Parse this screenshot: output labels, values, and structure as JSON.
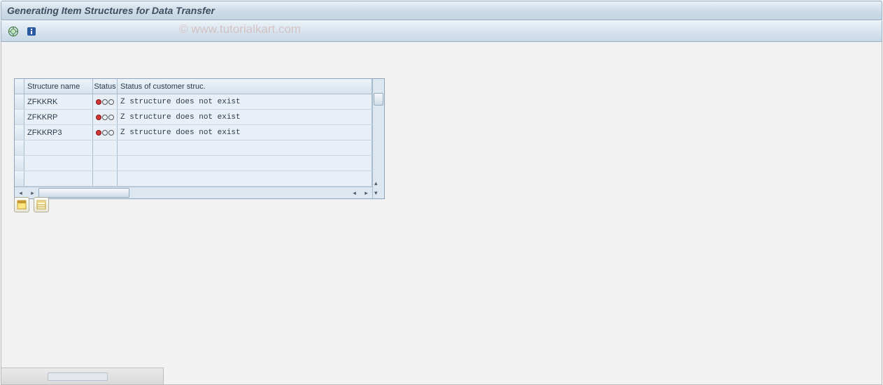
{
  "title": "Generating Item Structures for Data Transfer",
  "watermark": "© www.tutorialkart.com",
  "toolbar": {
    "execute_icon": "execute-icon",
    "info_icon": "info-icon"
  },
  "table": {
    "headers": {
      "name": "Structure name",
      "status": "Status",
      "cust_status": "Status of customer struc."
    },
    "rows": [
      {
        "name": "ZFKKRK",
        "status": "red",
        "cust_status": "Z structure does not exist"
      },
      {
        "name": "ZFKKRP",
        "status": "red",
        "cust_status": "Z structure does not exist"
      },
      {
        "name": "ZFKKRP3",
        "status": "red",
        "cust_status": "Z structure does not exist"
      }
    ],
    "empty_rows": 3
  },
  "bottom_buttons": {
    "select_all": "select-all",
    "deselect_all": "deselect-all"
  }
}
